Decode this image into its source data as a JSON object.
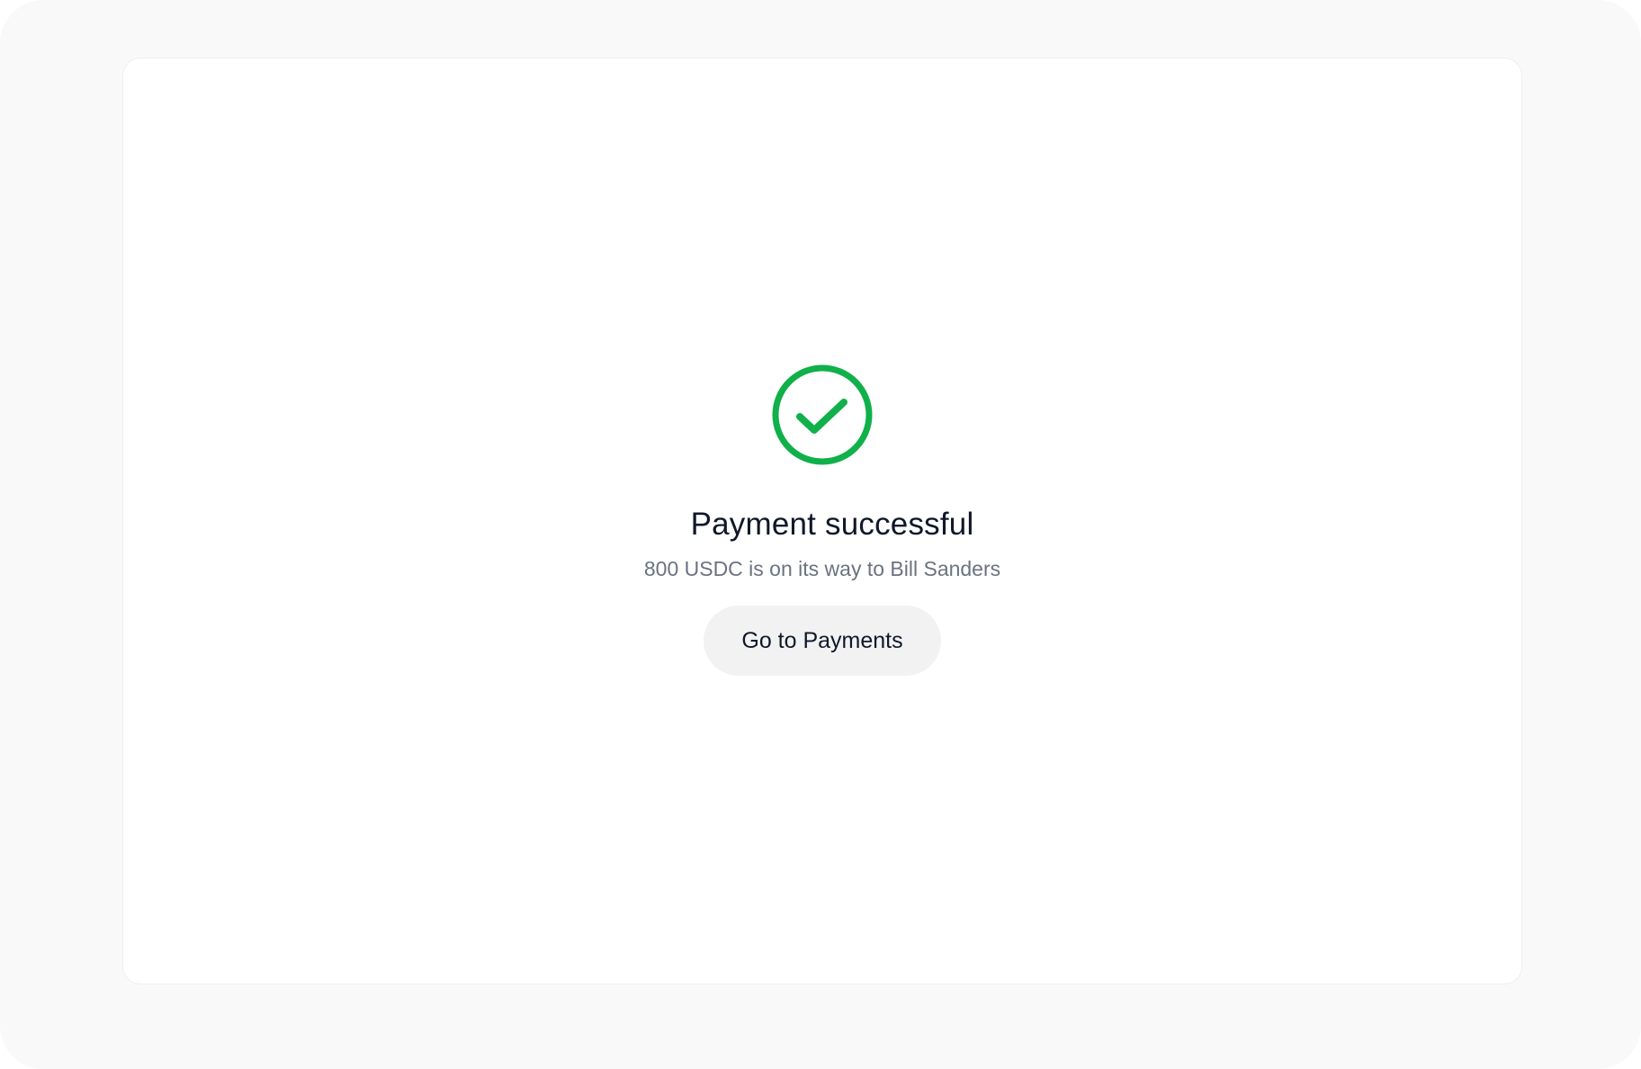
{
  "colors": {
    "page_background": "#f9f9f9",
    "card_background": "#ffffff",
    "success_green": "#10b04a",
    "title_text": "#101828",
    "subtitle_text": "#6b7280",
    "button_background": "#f2f2f3"
  },
  "icon": "check-circle-icon",
  "confirmation": {
    "title": "Payment successful",
    "message": "800 USDC is on its way to Bill Sanders"
  },
  "actions": {
    "go_to_payments_label": "Go to Payments"
  }
}
